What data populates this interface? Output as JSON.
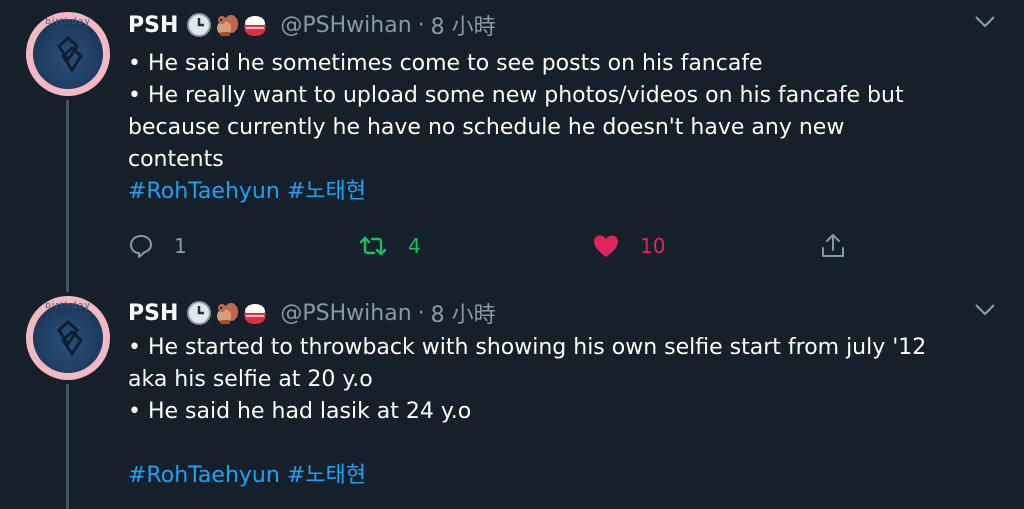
{
  "tweets": [
    {
      "display_name": "PSH",
      "handle": "@PSHwihan",
      "separator": "·",
      "time": "8 小時",
      "avatar_text": "birthday",
      "emojis": [
        "clock-emoji",
        "chipmunk-emoji",
        "rice-bowl-emoji"
      ],
      "lines": [
        "• He said he sometimes come to see posts on his fancafe",
        "• He really want to upload some new photos/videos on his fancafe but",
        "because currently he have no schedule he doesn't have any new",
        "contents"
      ],
      "hashtags": [
        "#RohTaehyun",
        "#노태현"
      ],
      "actions": {
        "replies": "1",
        "retweets": "4",
        "likes": "10"
      }
    },
    {
      "display_name": "PSH",
      "handle": "@PSHwihan",
      "separator": "·",
      "time": "8 小時",
      "avatar_text": "birthday",
      "emojis": [
        "clock-emoji",
        "chipmunk-emoji",
        "rice-bowl-emoji"
      ],
      "lines": [
        "• He started to throwback with showing his own selfie start from july '12",
        "aka his selfie at 20 y.o",
        "• He said he had lasik at 24 y.o"
      ],
      "hashtags": [
        "#RohTaehyun",
        "#노태현"
      ]
    }
  ],
  "colors": {
    "background": "#15202b",
    "secondary_text": "#8899a6",
    "hashtag": "#1da1f2",
    "retweet": "#17bf63",
    "like": "#e0245e",
    "thread_line": "#3d5466"
  }
}
